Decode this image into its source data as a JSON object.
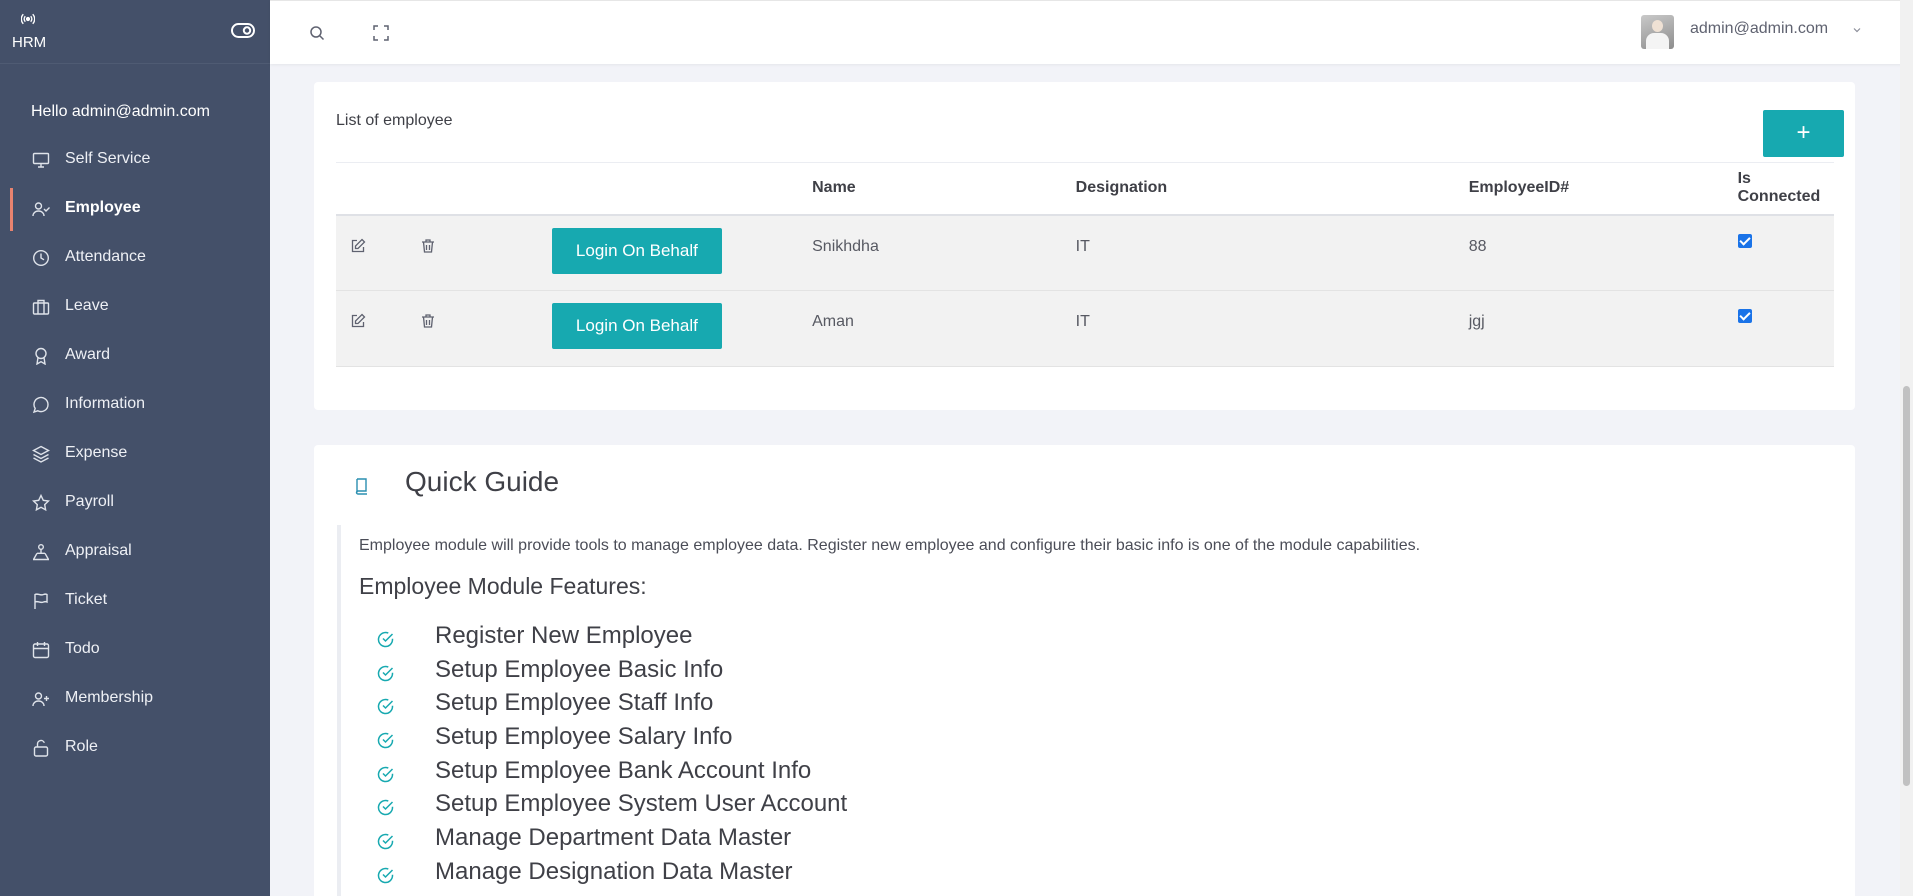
{
  "brand": {
    "name": "HRM"
  },
  "sidebar": {
    "greeting": "Hello admin@admin.com",
    "items": [
      {
        "label": "Self Service",
        "icon": "monitor-icon"
      },
      {
        "label": "Employee",
        "icon": "user-check-icon",
        "active": true
      },
      {
        "label": "Attendance",
        "icon": "clock-icon"
      },
      {
        "label": "Leave",
        "icon": "briefcase-icon"
      },
      {
        "label": "Award",
        "icon": "award-icon"
      },
      {
        "label": "Information",
        "icon": "message-circle-icon"
      },
      {
        "label": "Expense",
        "icon": "layers-icon"
      },
      {
        "label": "Payroll",
        "icon": "star-icon"
      },
      {
        "label": "Appraisal",
        "icon": "appraisal-icon"
      },
      {
        "label": "Ticket",
        "icon": "flag-icon"
      },
      {
        "label": "Todo",
        "icon": "calendar-icon"
      },
      {
        "label": "Membership",
        "icon": "user-plus-icon"
      },
      {
        "label": "Role",
        "icon": "unlock-icon"
      }
    ]
  },
  "topbar": {
    "user_email": "admin@admin.com"
  },
  "employee_list": {
    "title": "List of employee",
    "add_label": "+",
    "columns": [
      "",
      "",
      "",
      "Name",
      "Designation",
      "EmployeeID#",
      "Is Connected"
    ],
    "rows": [
      {
        "action_label": "Login On Behalf",
        "name": "Snikhdha",
        "designation": "IT",
        "employee_id": "88",
        "connected": true
      },
      {
        "action_label": "Login On Behalf",
        "name": "Aman",
        "designation": "IT",
        "employee_id": "jgj",
        "connected": true
      }
    ]
  },
  "quick_guide": {
    "title": "Quick Guide",
    "description": "Employee module will provide tools to manage employee data. Register new employee and configure their basic info is one of the module capabilities.",
    "features_heading": "Employee Module Features:",
    "features": [
      "Register New Employee",
      "Setup Employee Basic Info",
      "Setup Employee Staff Info",
      "Setup Employee Salary Info",
      "Setup Employee Bank Account Info",
      "Setup Employee System User Account",
      "Manage Department Data Master",
      "Manage Designation Data Master"
    ]
  },
  "colors": {
    "sidebar_bg": "#445069",
    "accent": "#17a9b0",
    "active_marker": "#e8836f"
  }
}
